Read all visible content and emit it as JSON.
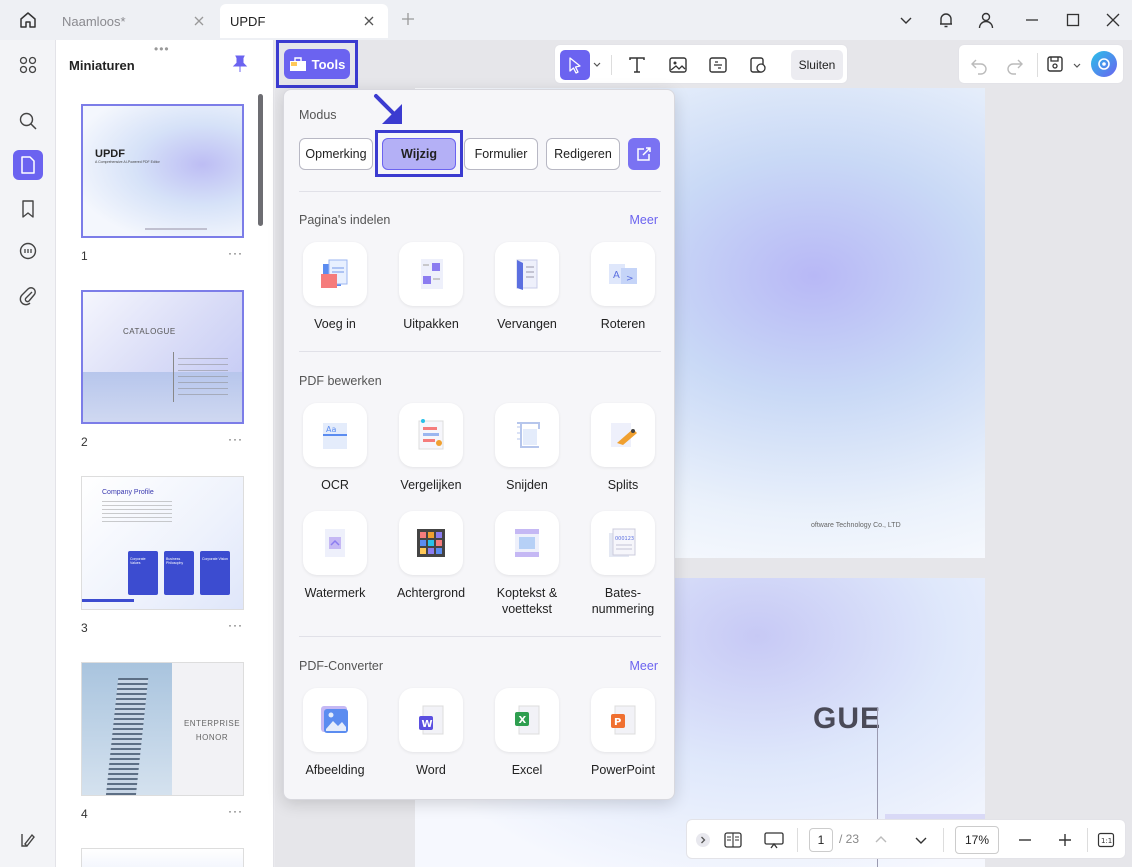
{
  "tabs": [
    {
      "label": "Naamloos*"
    },
    {
      "label": "UPDF"
    }
  ],
  "sidebar": {
    "title": "Miniaturen",
    "pages": [
      {
        "number": "1",
        "brand": "UPDF",
        "subtitle": "A Comprehensive AI-Powered PDF Editor"
      },
      {
        "number": "2",
        "heading": "CATALOGUE"
      },
      {
        "number": "3",
        "heading": "Company Profile",
        "cards": [
          "Corporate Values",
          "Business Philosophy",
          "Corporate Vision"
        ]
      },
      {
        "number": "4",
        "heading": "ENTERPRISE HONOR"
      }
    ],
    "more": "···"
  },
  "toolbar": {
    "tools_label": "Tools",
    "close_label": "Sluiten"
  },
  "panel": {
    "mode_title": "Modus",
    "modes": [
      "Opmerking",
      "Wijzig",
      "Formulier",
      "Redigeren"
    ],
    "sections": [
      {
        "title": "Pagina's indelen",
        "more": "Meer",
        "tools": [
          "Voeg in",
          "Uitpakken",
          "Vervangen",
          "Roteren"
        ]
      },
      {
        "title": "PDF bewerken",
        "tools": [
          "OCR",
          "Vergelijken",
          "Snijden",
          "Splits",
          "Watermerk",
          "Achtergrond",
          "Koptekst & voettekst",
          "Bates-nummering"
        ]
      },
      {
        "title": "PDF-Converter",
        "more": "Meer",
        "tools": [
          "Afbeelding",
          "Word",
          "Excel",
          "PowerPoint"
        ]
      }
    ]
  },
  "document": {
    "page1_footer": "oftware Technology Co., LTD",
    "page2_heading": "GUE"
  },
  "footer": {
    "page_current": "1",
    "page_total": "/ 23",
    "zoom": "17%"
  },
  "colors": {
    "accent": "#6b63f0",
    "highlight": "#3b3bd0"
  }
}
